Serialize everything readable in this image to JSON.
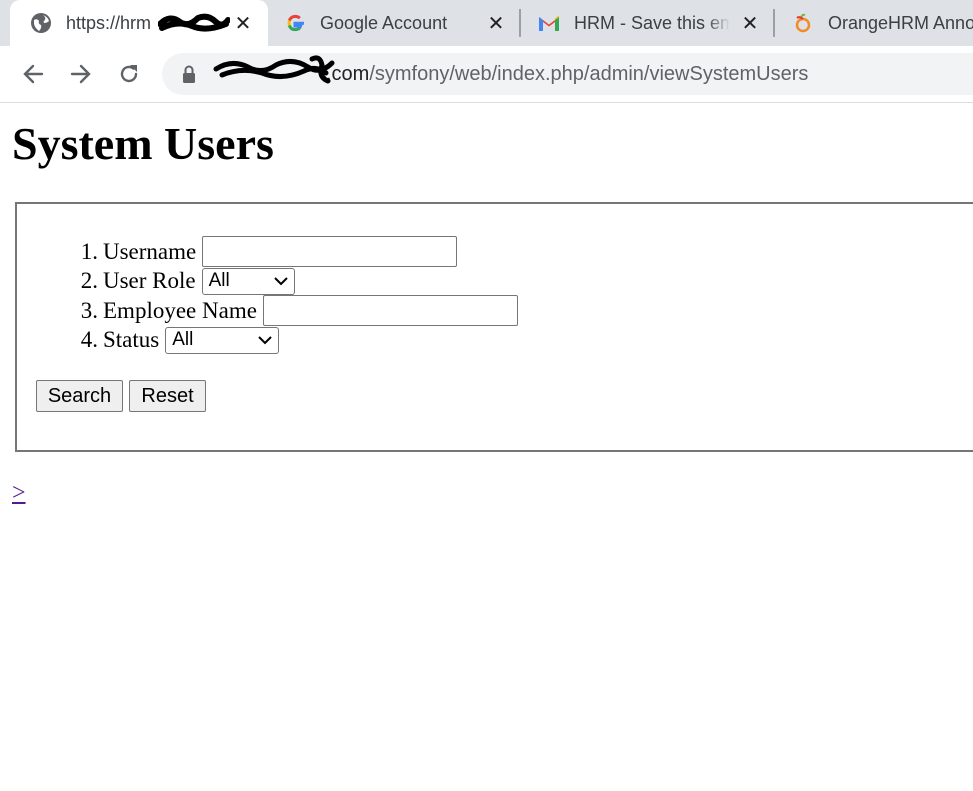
{
  "browser": {
    "tabs": [
      {
        "title": "https://hrm",
        "favicon": "globe-icon",
        "active": true
      },
      {
        "title": "Google Account",
        "favicon": "google-g-icon",
        "active": false
      },
      {
        "title": "HRM - Save this em",
        "favicon": "gmail-icon",
        "active": false
      },
      {
        "title": "OrangeHRM Anno",
        "favicon": "orangehrm-icon",
        "active": false
      }
    ],
    "url_host": ".com",
    "url_path": "/symfony/web/index.php/admin/viewSystemUsers"
  },
  "page": {
    "title": "System Users",
    "form": {
      "fields": [
        {
          "number": "1.",
          "label": "Username",
          "type": "text",
          "value": ""
        },
        {
          "number": "2.",
          "label": "User Role",
          "type": "select",
          "value": "All"
        },
        {
          "number": "3.",
          "label": "Employee Name",
          "type": "text",
          "value": ""
        },
        {
          "number": "4.",
          "label": "Status",
          "type": "select",
          "value": "All"
        }
      ],
      "search_label": "Search",
      "reset_label": "Reset"
    },
    "next_link": ">"
  },
  "colors": {
    "tabstrip_bg": "#dee1e6",
    "omnibox_bg": "#f1f3f4",
    "link_visited": "#551a8b"
  }
}
